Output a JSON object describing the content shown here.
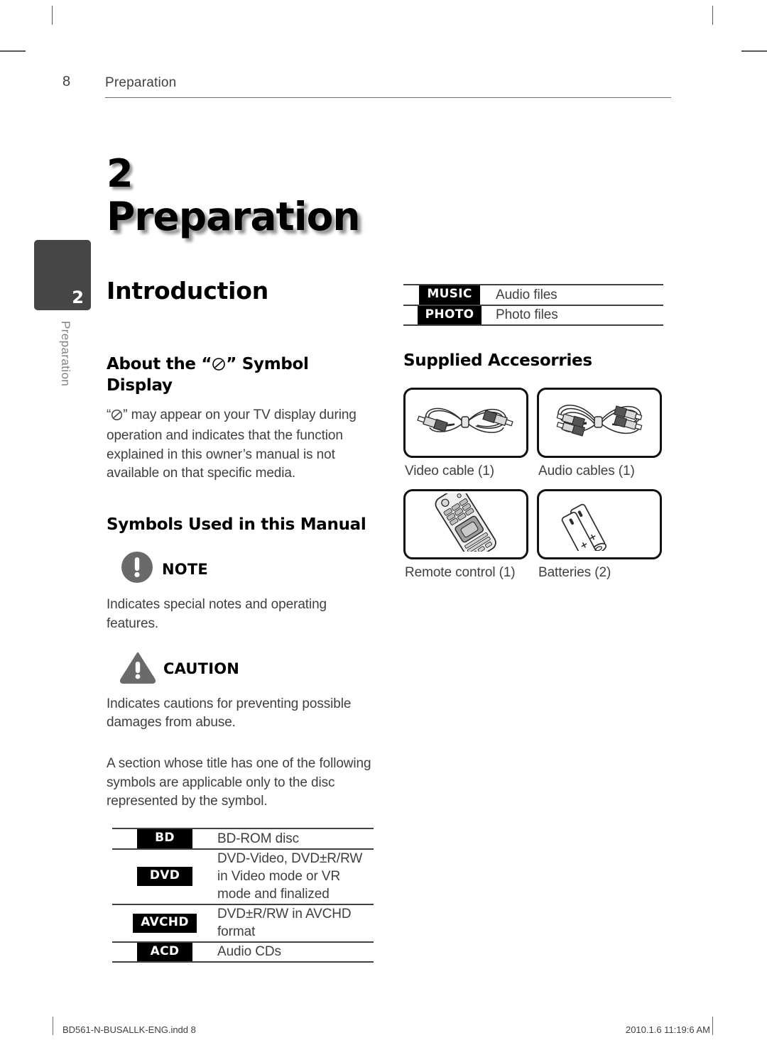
{
  "page": {
    "number": "8",
    "header_title": "Preparation",
    "chapter_number": "2",
    "chapter_title": "Preparation",
    "side_tab_number": "2",
    "side_tab_label": "Preparation"
  },
  "left_column": {
    "section_title": "Introduction",
    "about_symbol_heading_before": "About the “",
    "about_symbol_heading_after": "” Symbol Display",
    "about_symbol_icon": "no-symbol-icon",
    "about_paragraph_prefix": "“",
    "about_paragraph_suffix": "” may appear on your TV display during operation and indicates that the function explained in this owner’s manual is not available on that specific media.",
    "symbols_heading": "Symbols Used in this Manual",
    "note": {
      "icon": "note-exclamation-circle-icon",
      "title": "NOTE",
      "text": "Indicates special notes and operating features."
    },
    "caution": {
      "icon": "caution-exclamation-triangle-icon",
      "title": "CAUTION",
      "text": "Indicates cautions for preventing possible damages from abuse."
    },
    "disc_intro": "A section whose title has one of the following symbols are applicable only to the disc represented by the symbol.",
    "disc_table": [
      {
        "badge": "BD",
        "description": "BD-ROM disc"
      },
      {
        "badge": "DVD",
        "description": "DVD-Video, DVD±R/RW in Video mode or VR mode and finalized"
      },
      {
        "badge": "AVCHD",
        "description": "DVD±R/RW in AVCHD format"
      },
      {
        "badge": "ACD",
        "description": "Audio CDs"
      }
    ]
  },
  "right_column": {
    "file_table": [
      {
        "badge": "MUSIC",
        "description": "Audio files"
      },
      {
        "badge": "PHOTO",
        "description": "Photo files"
      }
    ],
    "accessories_heading": "Supplied Accesorries",
    "accessories": [
      {
        "icon": "video-cable-icon",
        "label": "Video cable (1)"
      },
      {
        "icon": "audio-cables-icon",
        "label": "Audio cables (1)"
      },
      {
        "icon": "remote-control-icon",
        "label": "Remote control (1)"
      },
      {
        "icon": "batteries-icon",
        "label": "Batteries (2)"
      }
    ]
  },
  "footer": {
    "file_name": "BD561-N-BUSALLK-ENG.indd   8",
    "timestamp": "2010.1.6   11:19:6 AM"
  },
  "colors": {
    "text": "#3f3f42",
    "badge_bg": "#000000",
    "tab_bg": "#464646",
    "rule": "#404041",
    "notice_icon": "#666666"
  }
}
